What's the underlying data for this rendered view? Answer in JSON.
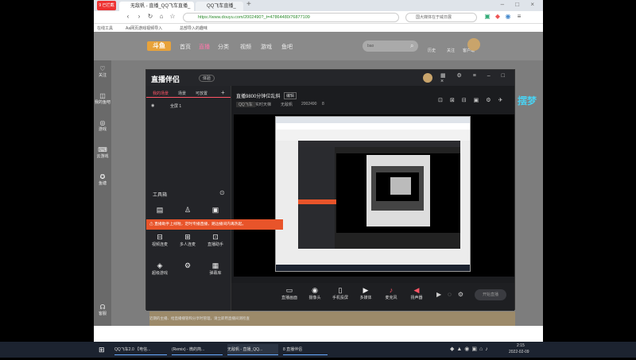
{
  "browser": {
    "brand_badge": "9 已拦截",
    "tabs": [
      "无敌帆 - 直播_QQ飞车直播_",
      "QQ飞车直播_"
    ],
    "new_tab": "+",
    "url_secure": "https",
    "url": "https://www.douyu.com/2002490?_t=47864480/76877109",
    "search_hint": "国大媒体在于威日展",
    "bookmarks": [
      "在线工具",
      "Aa网页游戏视频导入",
      "总部导入的趣味"
    ],
    "date": "2022-02-09"
  },
  "site": {
    "logo": "斗鱼",
    "nav": [
      "首页",
      "直播",
      "分类",
      "视频",
      "游戏",
      "鱼吧"
    ],
    "search_placeholder": "bao",
    "header_right": [
      "历史",
      "关注",
      "客户端"
    ],
    "left_rail": [
      "关注",
      "我的鱼吧",
      "游戏",
      "云游戏",
      "鱼塘",
      "客服"
    ],
    "side_banner": "摆梦"
  },
  "app": {
    "title": "直播伴侣",
    "badge": "体验",
    "side_tabs": [
      "我的场景",
      "场景",
      "可放置"
    ],
    "scene_item": "全屏 1",
    "toolbox_title": "工具箱",
    "alert": "⚠ 直播助手上线啦，定时专播直播，路边播间内再热起。",
    "tools": [
      "视频连麦",
      "多人连麦",
      "直播助手",
      "超级游戏",
      "",
      "弹幕库"
    ],
    "footer_note": "近期的主播、给直播播管和分享时管理，请立即用直播间测检查",
    "stream_title": "直播9800分钟位乱斜",
    "stream_edit": "编辑",
    "stream_meta": [
      "QQ飞车",
      "实时天梯",
      "无敌帆",
      "2002490",
      "8"
    ],
    "bottom_tools": [
      "直播画面",
      "摄像头",
      "手机投屏",
      "多媒体",
      "麦克风",
      "扬声器"
    ],
    "start_button": "开始直播"
  },
  "taskbar": {
    "items": [
      "QQ飞车2.0 【电信...",
      "(Remix) - 微的简...",
      "无敌帆 - 直播_QQ...",
      "8 直播伴侣"
    ],
    "time": "2:15",
    "date": "2022-02-09"
  }
}
